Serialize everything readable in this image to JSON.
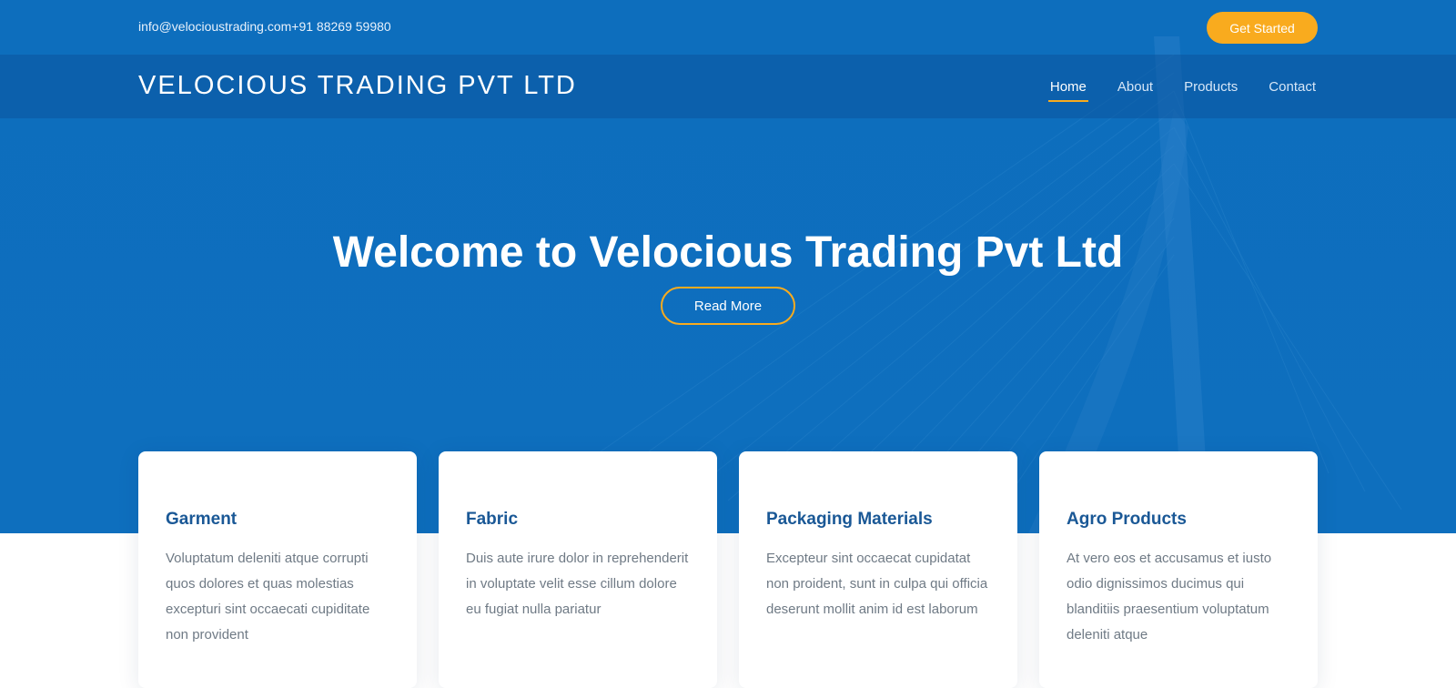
{
  "topbar": {
    "contact": "info@velocioustrading.com+91 88269 59980",
    "cta_label": "Get Started"
  },
  "header": {
    "brand": "VELOCIOUS TRADING PVT LTD",
    "nav": [
      {
        "label": "Home",
        "active": true
      },
      {
        "label": "About",
        "active": false
      },
      {
        "label": "Products",
        "active": false
      },
      {
        "label": "Contact",
        "active": false
      }
    ]
  },
  "hero": {
    "title": "Welcome to Velocious Trading Pvt Ltd",
    "button_label": "Read More"
  },
  "cards": [
    {
      "title": "Garment",
      "text": "Voluptatum deleniti atque corrupti quos dolores et quas molestias excepturi sint occaecati cupiditate non provident"
    },
    {
      "title": "Fabric",
      "text": "Duis aute irure dolor in reprehenderit in voluptate velit esse cillum dolore eu fugiat nulla pariatur"
    },
    {
      "title": "Packaging Materials",
      "text": "Excepteur sint occaecat cupidatat non proident, sunt in culpa qui officia deserunt mollit anim id est laborum"
    },
    {
      "title": "Agro Products",
      "text": "At vero eos et accusamus et iusto odio dignissimos ducimus qui blanditiis praesentium voluptatum deleniti atque"
    }
  ],
  "colors": {
    "hero_blue": "#0d6ebd",
    "accent": "#f9ab1e",
    "card_title": "#1a5896"
  }
}
